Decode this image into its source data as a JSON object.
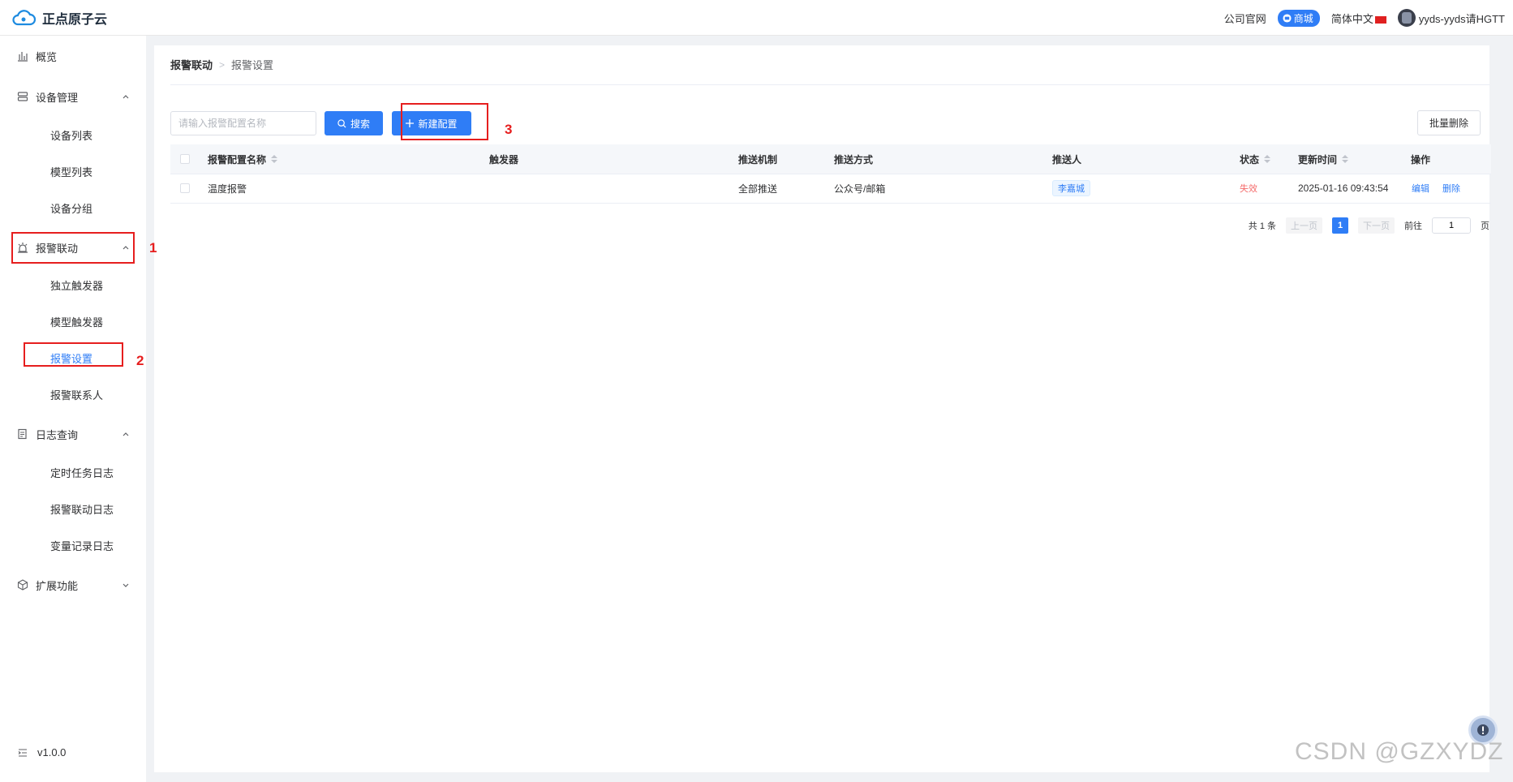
{
  "header": {
    "logo_text": "正点原子云",
    "company_site": "公司官网",
    "mall": "商城",
    "language": "简体中文",
    "username": "yyds-yyds请HGTT"
  },
  "sidebar": {
    "overview": "概览",
    "device_mgmt": "设备管理",
    "device_list": "设备列表",
    "model_list": "模型列表",
    "device_group": "设备分组",
    "alarm_linkage": "报警联动",
    "independent_trigger": "独立触发器",
    "model_trigger": "模型触发器",
    "alarm_settings": "报警设置",
    "alarm_contacts": "报警联系人",
    "log_query": "日志查询",
    "scheduled_task_log": "定时任务日志",
    "alarm_linkage_log": "报警联动日志",
    "variable_log": "变量记录日志",
    "extensions": "扩展功能",
    "version": "v1.0.0"
  },
  "breadcrumb": {
    "parent": "报警联动",
    "current": "报警设置"
  },
  "toolbar": {
    "search_placeholder": "请输入报警配置名称",
    "search_label": "搜索",
    "new_label": "新建配置",
    "batch_delete_label": "批量删除"
  },
  "annotations": {
    "n1": "1",
    "n2": "2",
    "n3": "3"
  },
  "table": {
    "headers": {
      "name": "报警配置名称",
      "trigger": "触发器",
      "mechanism": "推送机制",
      "method": "推送方式",
      "recipient": "推送人",
      "status": "状态",
      "updated": "更新时间",
      "actions": "操作"
    },
    "rows": [
      {
        "name": "温度报警",
        "trigger": "",
        "mechanism": "全部推送",
        "method": "公众号/邮箱",
        "recipient": "李嘉城",
        "status": "失效",
        "updated": "2025-01-16 09:43:54",
        "edit": "编辑",
        "delete": "删除"
      }
    ]
  },
  "pagination": {
    "total": "共 1 条",
    "prev": "上一页",
    "page": "1",
    "next": "下一页",
    "goto": "前往",
    "goto_value": "1",
    "page_unit": "页"
  },
  "watermark": "CSDN @GZXYDZ",
  "colors": {
    "primary": "#2f7df6",
    "annotation": "#e61e1e",
    "danger": "#f56c6c"
  }
}
